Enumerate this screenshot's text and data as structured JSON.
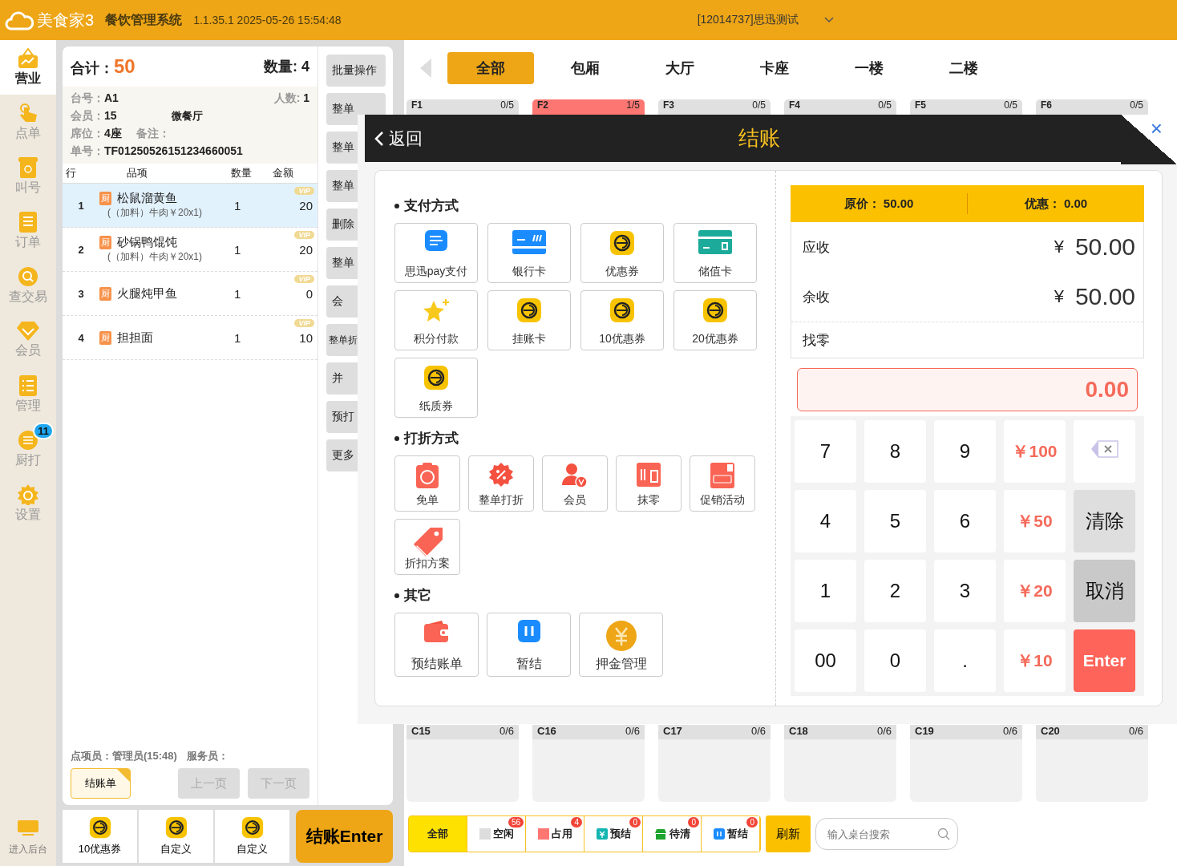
{
  "header": {
    "logo": "美食家3",
    "title": "餐饮管理系统",
    "version": "1.1.35.1 2025-05-26 15:54:48",
    "store": "[12014737]思迅测试"
  },
  "nav": [
    {
      "label": "营业",
      "kind": "shop",
      "selected": true
    },
    {
      "label": "点单",
      "kind": "hand",
      "selected": false
    },
    {
      "label": "叫号",
      "kind": "number",
      "selected": false
    },
    {
      "label": "订单",
      "kind": "list",
      "selected": false
    },
    {
      "label": "查交易",
      "kind": "search",
      "selected": false
    },
    {
      "label": "会员",
      "kind": "diamond",
      "selected": false
    },
    {
      "label": "管理",
      "kind": "checklist",
      "selected": false
    },
    {
      "label": "厨打",
      "kind": "printer",
      "selected": false,
      "badge": "11"
    },
    {
      "label": "设置",
      "kind": "gear",
      "selected": false
    }
  ],
  "backend": {
    "label": "进入后台"
  },
  "order": {
    "total_label": "合计：",
    "total": "50",
    "count_label": "数量:",
    "count": "4",
    "info": [
      {
        "label": "台号：",
        "value": "A1",
        "side_label": "人数:",
        "side_value": "1"
      },
      {
        "label": "会员：",
        "value": "15",
        "side_value": "微餐厅"
      },
      {
        "label": "席位：",
        "value": "4座",
        "side_label": "备注："
      },
      {
        "label": "单号：",
        "value": "TF01250526151234660051"
      }
    ],
    "columns": [
      "行",
      "品项",
      "数量",
      "金额"
    ],
    "items": [
      {
        "row": "1",
        "tag": "厨",
        "name": "松鼠溜黄鱼",
        "extra": "(（加料）牛肉￥20x1)",
        "qty": "1",
        "amount": "20",
        "vip": "VIP",
        "selected": true
      },
      {
        "row": "2",
        "tag": "厨",
        "name": "砂锅鸭馄饨",
        "extra": "(（加料）牛肉￥20x1)",
        "qty": "1",
        "amount": "20",
        "vip": "VIP",
        "selected": false
      },
      {
        "row": "3",
        "tag": "厨",
        "name": "火腿炖甲鱼",
        "qty": "1",
        "amount": "0",
        "vip": "VIP",
        "selected": false
      },
      {
        "row": "4",
        "tag": "厨",
        "name": "担担面",
        "qty": "1",
        "amount": "10",
        "vip": "VIP",
        "selected": false
      }
    ],
    "clerk": "点项员：管理员(15:48)",
    "waiter": "服务员：",
    "receipt": {
      "label": "结账单",
      "checked": true
    },
    "pager": [
      {
        "label": "上一页",
        "disabled": true
      },
      {
        "label": "下一页",
        "disabled": true
      }
    ]
  },
  "side_buttons": [
    "批量操作",
    "整单",
    "整单",
    "整单",
    "删除",
    "整单",
    "会",
    "整单折",
    "并",
    "预打",
    "更多"
  ],
  "quick": [
    {
      "label": "10优惠券"
    },
    {
      "label": "自定义"
    },
    {
      "label": "自定义"
    }
  ],
  "checkout": "结账Enter",
  "areas": [
    {
      "label": "全部",
      "selected": true
    },
    {
      "label": "包厢",
      "selected": false
    },
    {
      "label": "大厅",
      "selected": false
    },
    {
      "label": "卡座",
      "selected": false
    },
    {
      "label": "一楼",
      "selected": false
    },
    {
      "label": "二楼",
      "selected": false
    }
  ],
  "top_tables": [
    {
      "name": "F1",
      "seats": "0/5",
      "occupied": false
    },
    {
      "name": "F2",
      "seats": "1/5",
      "occupied": true
    },
    {
      "name": "F3",
      "seats": "0/5",
      "occupied": false
    },
    {
      "name": "F4",
      "seats": "0/5",
      "occupied": false
    },
    {
      "name": "F5",
      "seats": "0/5",
      "occupied": false
    },
    {
      "name": "F6",
      "seats": "0/5",
      "occupied": false
    }
  ],
  "bottom_tables": [
    {
      "name": "C15",
      "seats": "0/6",
      "occupied": false
    },
    {
      "name": "C16",
      "seats": "0/6",
      "occupied": false
    },
    {
      "name": "C17",
      "seats": "0/6",
      "occupied": false
    },
    {
      "name": "C18",
      "seats": "0/6",
      "occupied": false
    },
    {
      "name": "C19",
      "seats": "0/6",
      "occupied": false
    },
    {
      "name": "C20",
      "seats": "0/6",
      "occupied": false
    }
  ],
  "filters": [
    {
      "label": "全部",
      "kind": "all",
      "selected": true
    },
    {
      "label": "空闲",
      "kind": "idle",
      "count": "56",
      "selected": false
    },
    {
      "label": "占用",
      "kind": "busy",
      "count": "4",
      "selected": false
    },
    {
      "label": "预结",
      "kind": "prebill",
      "count": "0",
      "selected": false
    },
    {
      "label": "待清",
      "kind": "clean",
      "count": "0",
      "selected": false
    },
    {
      "label": "暂结",
      "kind": "pause",
      "count": "0",
      "selected": false
    }
  ],
  "refresh": "刷新",
  "search": {
    "placeholder": "输入桌台搜索"
  },
  "checkout_dialog": {
    "back": "返回",
    "title": "结账",
    "close": "×",
    "sections": [
      {
        "title": "支付方式",
        "kind": "pay",
        "options": [
          {
            "label": "思迅pay支付",
            "kind": "pay"
          },
          {
            "label": "银行卡",
            "kind": "bankcard"
          },
          {
            "label": "优惠券",
            "kind": "coupon"
          },
          {
            "label": "储值卡",
            "kind": "storedcard"
          },
          {
            "label": "积分付款",
            "kind": "star"
          },
          {
            "label": "挂账卡",
            "kind": "coupon"
          },
          {
            "label": "10优惠券",
            "kind": "coupon"
          },
          {
            "label": "20优惠券",
            "kind": "coupon"
          },
          {
            "label": "纸质券",
            "kind": "coupon"
          }
        ]
      },
      {
        "title": "打折方式",
        "kind": "discount",
        "options": [
          {
            "label": "免单",
            "kind": "free"
          },
          {
            "label": "整单打折",
            "kind": "percent"
          },
          {
            "label": "会员",
            "kind": "member"
          },
          {
            "label": "抹零",
            "kind": "erase"
          },
          {
            "label": "促销活动",
            "kind": "sale"
          },
          {
            "label": "折扣方案",
            "kind": "tag"
          }
        ]
      },
      {
        "title": "其它",
        "kind": "other",
        "options": [
          {
            "label": "预结账单",
            "kind": "wallet"
          },
          {
            "label": "暂结",
            "kind": "pause"
          },
          {
            "label": "押金管理",
            "kind": "yuan"
          }
        ]
      }
    ],
    "original_label": "原价：",
    "original": "50.00",
    "discount_label": "优惠：",
    "discount": "0.00",
    "amounts": [
      {
        "label": "应收",
        "currency": "¥",
        "value": "50.00"
      },
      {
        "label": "余收",
        "currency": "¥",
        "value": "50.00"
      },
      {
        "label": "找零"
      }
    ],
    "input": {
      "value": "0.00"
    },
    "keys": [
      {
        "label": "7",
        "kind": "digit"
      },
      {
        "label": "8",
        "kind": "digit"
      },
      {
        "label": "9",
        "kind": "digit"
      },
      {
        "label": "￥100",
        "kind": "cash"
      },
      {
        "kind": "backspace"
      },
      {
        "label": "4",
        "kind": "digit"
      },
      {
        "label": "5",
        "kind": "digit"
      },
      {
        "label": "6",
        "kind": "digit"
      },
      {
        "label": "￥50",
        "kind": "cash"
      },
      {
        "label": "清除",
        "kind": "clear"
      },
      {
        "label": "1",
        "kind": "digit"
      },
      {
        "label": "2",
        "kind": "digit"
      },
      {
        "label": "3",
        "kind": "digit"
      },
      {
        "label": "￥20",
        "kind": "cash"
      },
      {
        "label": "取消",
        "kind": "cancel"
      },
      {
        "label": "00",
        "kind": "digit"
      },
      {
        "label": "0",
        "kind": "digit"
      },
      {
        "label": ".",
        "kind": "digit"
      },
      {
        "label": "￥10",
        "kind": "cash"
      },
      {
        "label": "Enter",
        "kind": "enter"
      }
    ]
  }
}
